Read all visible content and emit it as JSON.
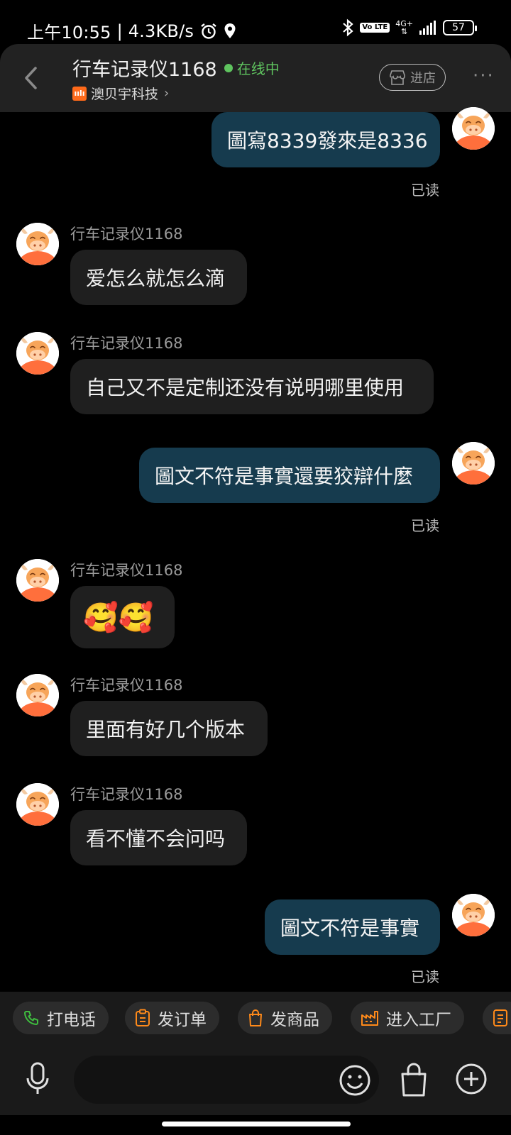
{
  "status_bar": {
    "time": "上午10:55",
    "speed": "| 4.3KB/s",
    "network_top": "4G+",
    "volte": "Vo LTE",
    "battery": "57"
  },
  "header": {
    "title": "行车记录仪1168",
    "status": "在线中",
    "company": "澳贝宇科技",
    "company_logo": "ıılı",
    "store_button": "进店"
  },
  "messages": [
    {
      "dir": "out",
      "text": "圖寫8339發來是8336",
      "read": "已读"
    },
    {
      "dir": "in",
      "sender": "行车记录仪1168",
      "text": "爱怎么就怎么滴"
    },
    {
      "dir": "in",
      "sender": "行车记录仪1168",
      "text": "自己又不是定制还没有说明哪里使用"
    },
    {
      "dir": "out",
      "text": "圖文不符是事實還要狡辯什麼",
      "read": "已读"
    },
    {
      "dir": "in",
      "sender": "行车记录仪1168",
      "text": "🥰🥰"
    },
    {
      "dir": "in",
      "sender": "行车记录仪1168",
      "text": "里面有好几个版本"
    },
    {
      "dir": "in",
      "sender": "行车记录仪1168",
      "text": "看不懂不会问吗"
    },
    {
      "dir": "out",
      "text": "圖文不符是事實",
      "read": "已读"
    }
  ],
  "quick_actions": [
    {
      "label": "打电话",
      "icon": "phone-icon",
      "color": "#3fbf3f"
    },
    {
      "label": "发订单",
      "icon": "clipboard-icon",
      "color": "#ff8a1a"
    },
    {
      "label": "发商品",
      "icon": "shopping-bag-icon",
      "color": "#ff8a1a"
    },
    {
      "label": "进入工厂",
      "icon": "factory-icon",
      "color": "#ff8a1a"
    }
  ],
  "input": {
    "placeholder": ""
  },
  "colors": {
    "accent": "#ff8a1a",
    "online": "#5fc45f",
    "outgoing_bubble": "#163b4e",
    "incoming_bubble": "#1f1f1f"
  }
}
